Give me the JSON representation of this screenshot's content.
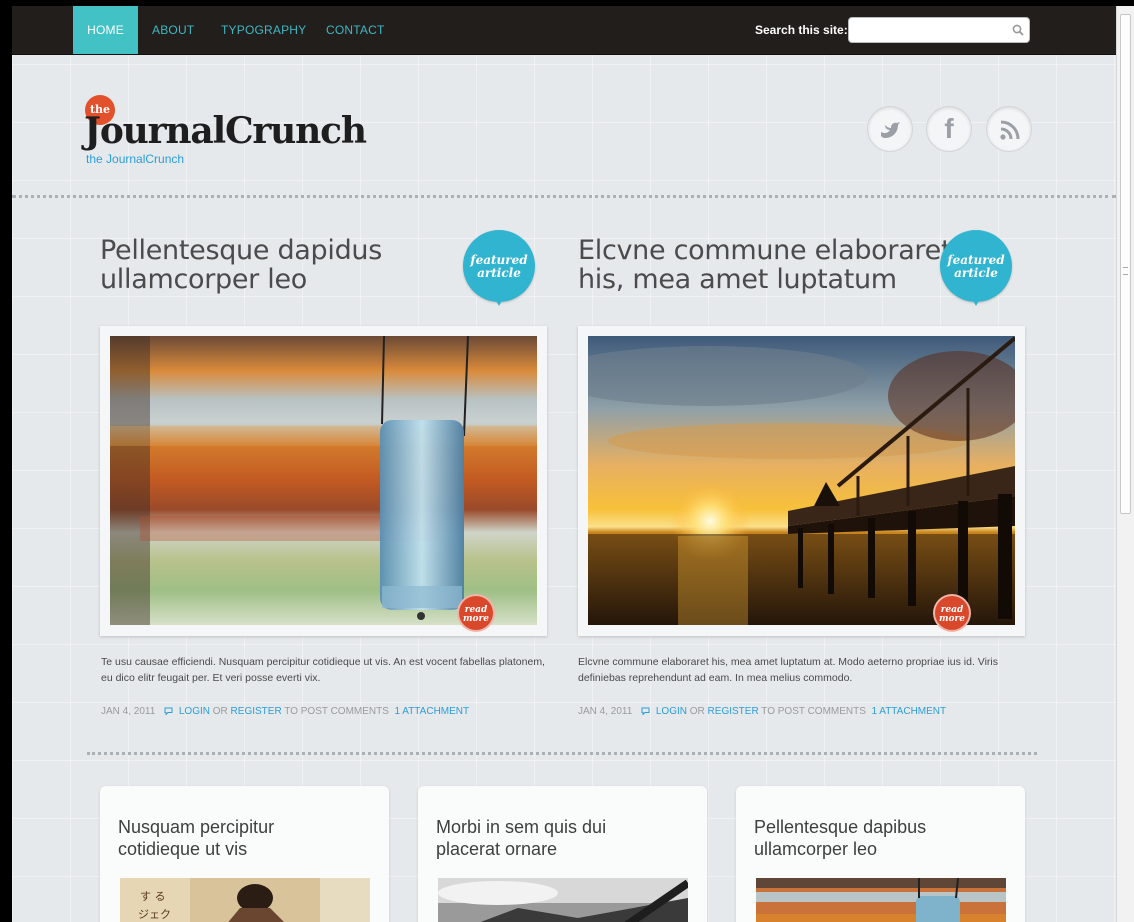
{
  "nav": {
    "items": [
      "HOME",
      "ABOUT",
      "TYPOGRAPHY",
      "CONTACT"
    ],
    "active": "HOME",
    "search_label": "Search this site:",
    "search_value": ""
  },
  "header": {
    "logo_badge": "the",
    "logo_text": "JournalCrunch",
    "tagline": "the JournalCrunch",
    "social": [
      "twitter-icon",
      "facebook-icon",
      "rss-icon"
    ]
  },
  "featured": [
    {
      "title_line1": "Pellentesque dapidus",
      "title_line2": "ullamcorper leo",
      "badge_line1": "featured",
      "badge_line2": "article",
      "read_more_line1": "read",
      "read_more_line2": "more",
      "excerpt": "Te usu causae efficiendi. Nusquam percipitur cotidieque ut vis. An est vocent fabellas platonem, eu dico elitr feugait per. Et veri posse everti vix.",
      "date": "JAN 4, 2011",
      "login": "LOGIN",
      "or": "OR",
      "register": "REGISTER",
      "post_comments": "TO POST COMMENTS",
      "attachment": "1 ATTACHMENT"
    },
    {
      "title_line1": "Elcvne commune elaboraret",
      "title_line2": "his, mea amet luptatum",
      "badge_line1": "featured",
      "badge_line2": "article",
      "read_more_line1": "read",
      "read_more_line2": "more",
      "excerpt": "Elcvne commune elaboraret his, mea amet luptatum at. Modo aeterno propriae ius id. Viris definiebas reprehendunt ad eam. In mea melius commodo.",
      "date": "JAN 4, 2011",
      "login": "LOGIN",
      "or": "OR",
      "register": "REGISTER",
      "post_comments": "TO POST COMMENTS",
      "attachment": "1 ATTACHMENT"
    }
  ],
  "cards": [
    {
      "title_line1": "Nusquam percipitur",
      "title_line2": "cotidieque ut vis"
    },
    {
      "title_line1": "Morbi in sem quis dui",
      "title_line2": "placerat ornare"
    },
    {
      "title_line1": "Pellentesque dapibus",
      "title_line2": "ullamcorper leo"
    }
  ],
  "colors": {
    "nav_bg": "#221e1c",
    "accent_teal": "#43c2c6",
    "link_blue": "#2a9ed8",
    "badge_teal": "#31b4cf",
    "readmore_red": "#d9482b",
    "logo_orange": "#e2512b"
  }
}
